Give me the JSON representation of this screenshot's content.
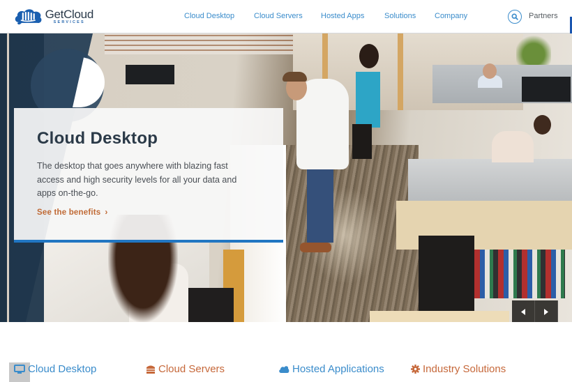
{
  "header": {
    "logo": {
      "name": "GetCloud",
      "sub": "SERVICES"
    },
    "nav": [
      "Cloud Desktop",
      "Cloud Servers",
      "Hosted Apps",
      "Solutions",
      "Company"
    ],
    "search_icon": "search-icon",
    "partners_label": "Partners"
  },
  "hero": {
    "slide": {
      "title": "Cloud Desktop",
      "description": "The desktop that goes anywhere with blazing fast access and high security levels for all your data and apps on-the-go.",
      "link_label": "See the benefits",
      "link_icon": "chevron-right-icon"
    },
    "controls": {
      "prev_icon": "arrow-left-icon",
      "next_icon": "arrow-right-icon"
    }
  },
  "categories": [
    {
      "label": "Cloud Desktop",
      "icon": "monitor-icon",
      "color": "#3a8ccb"
    },
    {
      "label": "Cloud Servers",
      "icon": "server-icon",
      "color": "#c6683a"
    },
    {
      "label": "Hosted Applications",
      "icon": "cloud-icon",
      "color": "#3a8ccb"
    },
    {
      "label": "Industry Solutions",
      "icon": "gear-icon",
      "color": "#c6683a"
    }
  ],
  "colors": {
    "accent_blue": "#3a8ccb",
    "accent_orange": "#c6683a",
    "navy": "#223b52",
    "card_bar": "#2176c2"
  }
}
